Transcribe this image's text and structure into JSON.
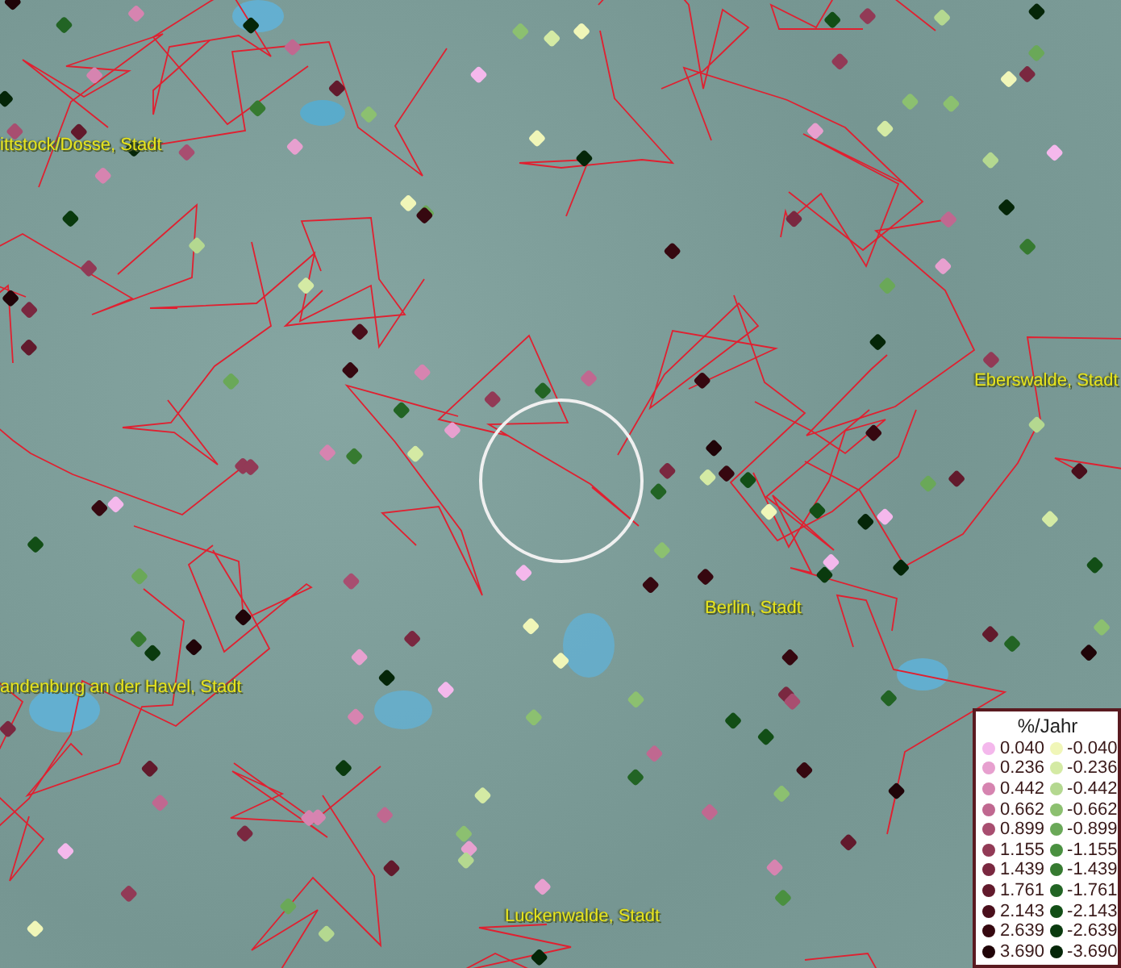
{
  "map": {
    "place_labels": [
      {
        "text": "ittstock/Dosse, Stadt"
      },
      {
        "text": "Eberswalde, Stadt"
      },
      {
        "text": "Berlin, Stadt"
      },
      {
        "text": "andenburg an der Havel, Stadt"
      },
      {
        "text": "Luckenwalde, Stadt"
      }
    ]
  },
  "legend": {
    "title": "%/Jahr",
    "positive": [
      {
        "value": "0.040",
        "color": "#f4b8ec"
      },
      {
        "value": "0.236",
        "color": "#e7a0cf"
      },
      {
        "value": "0.442",
        "color": "#d684b0"
      },
      {
        "value": "0.662",
        "color": "#c06890"
      },
      {
        "value": "0.899",
        "color": "#a84e70"
      },
      {
        "value": "1.155",
        "color": "#923a56"
      },
      {
        "value": "1.439",
        "color": "#7a2840"
      },
      {
        "value": "1.761",
        "color": "#621a2c"
      },
      {
        "value": "2.143",
        "color": "#4a0f1c"
      },
      {
        "value": "2.639",
        "color": "#360810"
      },
      {
        "value": "3.690",
        "color": "#200408"
      }
    ],
    "negative": [
      {
        "value": "-0.040",
        "color": "#f0f6b8"
      },
      {
        "value": "-0.236",
        "color": "#d4eaa4"
      },
      {
        "value": "-0.442",
        "color": "#b4d890"
      },
      {
        "value": "-0.662",
        "color": "#8cc070"
      },
      {
        "value": "-0.899",
        "color": "#6aa858"
      },
      {
        "value": "-1.155",
        "color": "#4a9040"
      },
      {
        "value": "-1.439",
        "color": "#367a30"
      },
      {
        "value": "-1.761",
        "color": "#226424"
      },
      {
        "value": "-2.143",
        "color": "#124e16"
      },
      {
        "value": "-2.639",
        "color": "#0a3a0e"
      },
      {
        "value": "-3.690",
        "color": "#052608"
      }
    ]
  }
}
